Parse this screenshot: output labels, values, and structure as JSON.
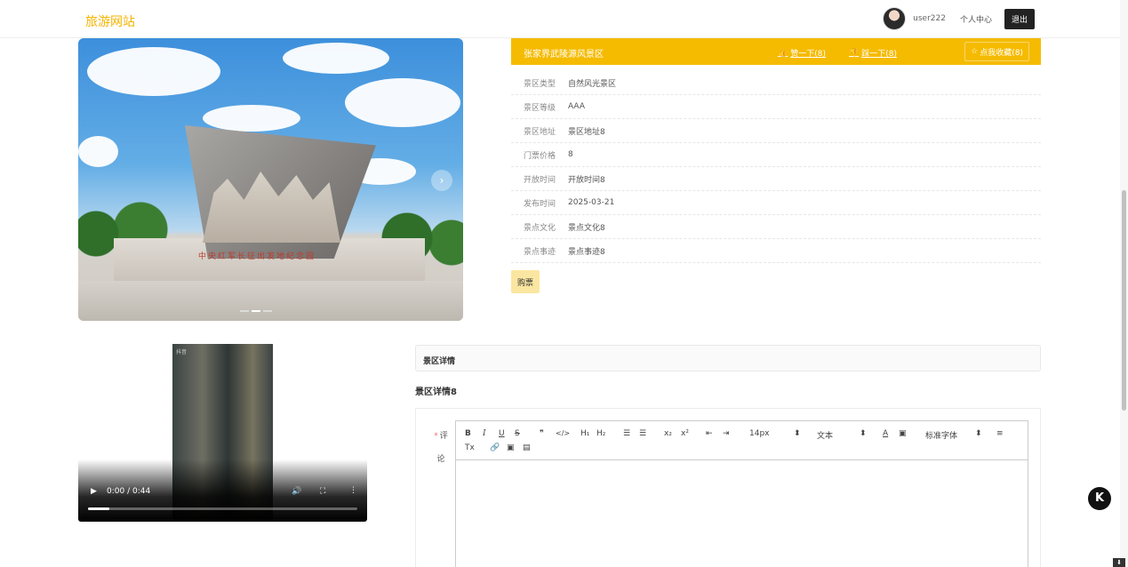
{
  "header": {
    "brand": "旅游网站",
    "user_name": "user222",
    "center_label": "个人中心",
    "logout_label": "退出"
  },
  "carousel": {
    "inscription": "中央红军长征出发地纪念园",
    "next_arrow": "›",
    "slide_count": 3,
    "active_slide": 2
  },
  "scenic": {
    "name": "张家界武陵源风景区",
    "like_label": "赞一下(8)",
    "dislike_label": "踩一下(8)",
    "collect_label": "点我收藏(8)",
    "buy_label": "购票",
    "fields": [
      {
        "label": "景区类型",
        "value": "自然风光景区"
      },
      {
        "label": "景区等级",
        "value": "AAA"
      },
      {
        "label": "景区地址",
        "value": "景区地址8"
      },
      {
        "label": "门票价格",
        "value": "8"
      },
      {
        "label": "开放时间",
        "value": "开放时间8"
      },
      {
        "label": "发布时间",
        "value": "2025-03-21"
      },
      {
        "label": "景点文化",
        "value": "景点文化8"
      },
      {
        "label": "景点事迹",
        "value": "景点事迹8"
      }
    ]
  },
  "video": {
    "time": "0:00 / 0:44",
    "progress": 0.08,
    "frame_label": "抖音"
  },
  "detail": {
    "tab_label": "景区详情",
    "content": "景区详情8"
  },
  "comment": {
    "required_mark": "*",
    "label": "评论",
    "toolbar": {
      "bold": "B",
      "italic": "I",
      "underline": "U",
      "strike": "S",
      "quote": "❞",
      "code": "</>",
      "h1": "H₁",
      "h2": "H₂",
      "ordered_list": "☰",
      "bullet_list": "☰",
      "subscript": "x₂",
      "superscript": "x²",
      "indent_left": "⇤",
      "indent_right": "⇥",
      "size_value": "14px",
      "header_value": "文本",
      "font_color": "A",
      "background_color": "▣",
      "font_value": "标准字体",
      "align": "≡",
      "clean": "Tx",
      "link": "🔗",
      "image": "▣",
      "video": "▤",
      "select_arrow": "⬍"
    }
  },
  "widgets": {
    "k_badge": "K",
    "corner": "⬇"
  },
  "colors": {
    "brand": "#f4b400",
    "header_bar": "#f5bb00",
    "buy_button": "#fbe6a1"
  }
}
